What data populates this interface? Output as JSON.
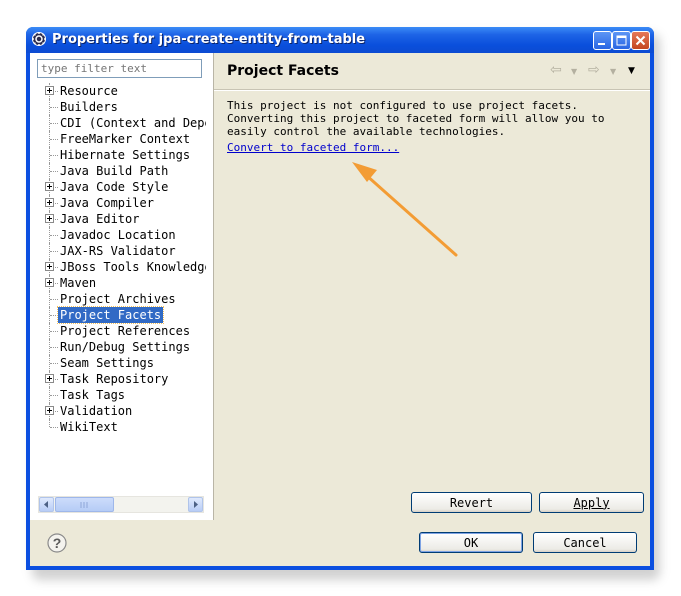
{
  "window": {
    "title": "Properties for jpa-create-entity-from-table"
  },
  "filter": {
    "placeholder": "type filter text"
  },
  "tree": {
    "items": [
      {
        "label": "Resource",
        "expandable": true
      },
      {
        "label": "Builders",
        "expandable": false
      },
      {
        "label": "CDI (Context and Dependency Injection) Settings",
        "expandable": false
      },
      {
        "label": "FreeMarker Context",
        "expandable": false
      },
      {
        "label": "Hibernate Settings",
        "expandable": false
      },
      {
        "label": "Java Build Path",
        "expandable": false
      },
      {
        "label": "Java Code Style",
        "expandable": true
      },
      {
        "label": "Java Compiler",
        "expandable": true
      },
      {
        "label": "Java Editor",
        "expandable": true
      },
      {
        "label": "Javadoc Location",
        "expandable": false
      },
      {
        "label": "JAX-RS Validator",
        "expandable": false
      },
      {
        "label": "JBoss Tools Knowledge Base",
        "expandable": true
      },
      {
        "label": "Maven",
        "expandable": true
      },
      {
        "label": "Project Archives",
        "expandable": false
      },
      {
        "label": "Project Facets",
        "expandable": false,
        "selected": true
      },
      {
        "label": "Project References",
        "expandable": false
      },
      {
        "label": "Run/Debug Settings",
        "expandable": false
      },
      {
        "label": "Seam Settings",
        "expandable": false
      },
      {
        "label": "Task Repository",
        "expandable": true
      },
      {
        "label": "Task Tags",
        "expandable": false
      },
      {
        "label": "Validation",
        "expandable": true
      },
      {
        "label": "WikiText",
        "expandable": false
      }
    ]
  },
  "page": {
    "title": "Project Facets",
    "message_lines": [
      "This project is not configured to use project facets.",
      "Converting this project to faceted form will allow you to",
      "easily control the available technologies."
    ],
    "convert_link": "Convert to faceted form..."
  },
  "buttons": {
    "revert": "Revert",
    "apply": "Apply",
    "ok": "OK",
    "cancel": "Cancel"
  },
  "colors": {
    "titlebar": "#0a4fdc",
    "selection": "#316ac5",
    "link": "#0000cc",
    "annotation_arrow": "#f39c34"
  }
}
